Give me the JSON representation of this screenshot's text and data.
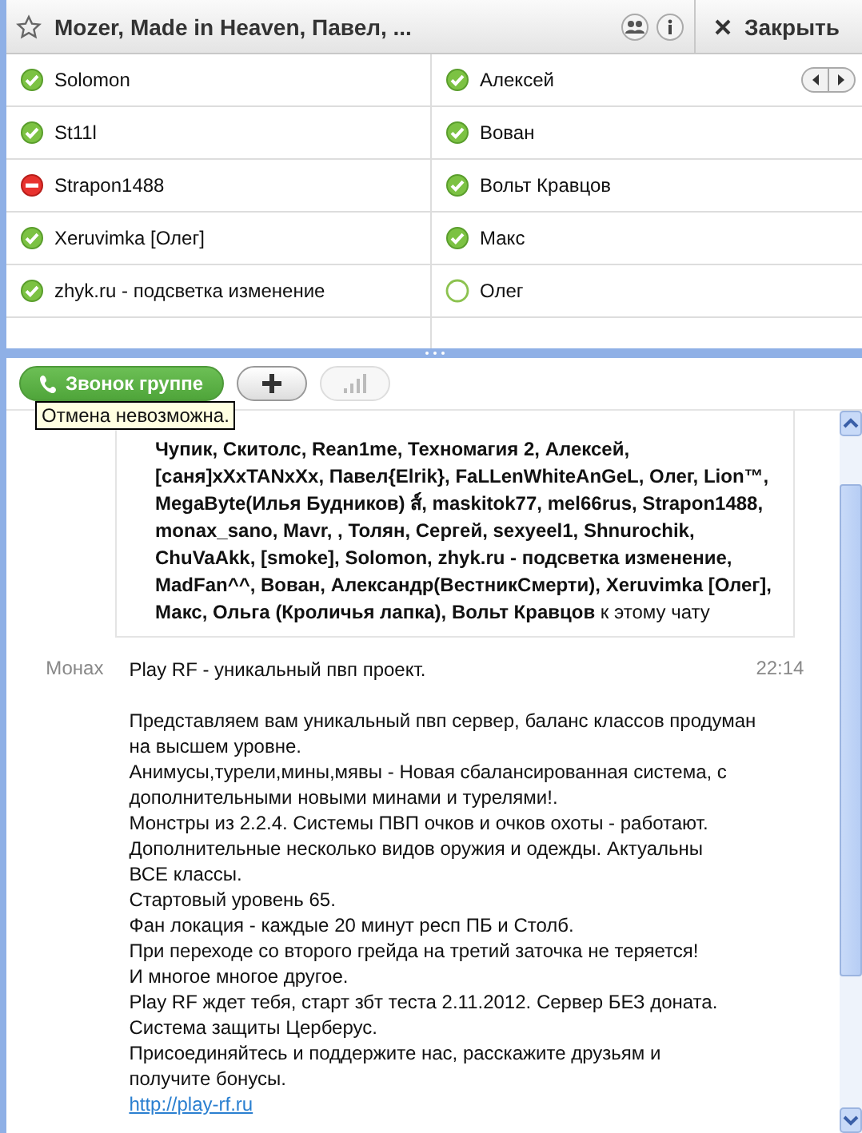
{
  "header": {
    "title": "Mozer, Made in Heaven, Павел, ...",
    "favorite": false,
    "close_label": "Закрыть"
  },
  "participants": [
    {
      "name": "Solomon",
      "kind": "online"
    },
    {
      "name": "Алексей",
      "kind": "online"
    },
    {
      "name": "St11l",
      "kind": "online"
    },
    {
      "name": "Вован",
      "kind": "online"
    },
    {
      "name": "Strapon1488",
      "kind": "busy"
    },
    {
      "name": "Вольт Кравцов",
      "kind": "online"
    },
    {
      "name": "Xeruvimka [Олег]",
      "kind": "online"
    },
    {
      "name": "Макс",
      "kind": "online"
    },
    {
      "name": "zhyk.ru - подсветка изменение",
      "kind": "online"
    },
    {
      "name": "Олег",
      "kind": "offline"
    }
  ],
  "toolbar": {
    "call_label": "Звонок группе",
    "tooltip": "Отмена невозможна.",
    "quality_disabled": true
  },
  "system_message": {
    "text": "**Чупик, Скитолс, Rean1me, Техномагия 2, Алексей, [саня]xXxTANxXx, Павел{Elrik}, FaLLenWhiteAnGeL, Олег, Lion™, MegaByte(Илья Будников) ส์, maskitok77, mel66rus, Strapon1488, monax_sano, Mavr, , Толян, Сергей, sexyeel1, Shnurochik, ChuVaAkk, [smoke], Solomon, zhyk.ru - подсветка изменение, MadFan^^, Вован, Александр(ВестникСмерти), Xeruvimka [Олег], Макс, Ольга (Кроличья лапка), Вольт Кравцов** к этому чату"
  },
  "message": {
    "author": "Монах",
    "time": "22:14",
    "headline": "Play RF - уникальный пвп проект.",
    "lines": [
      "Представляем вам уникальный пвп сервер, баланс классов продуман",
      "на высшем уровне.",
      "Анимусы,турели,мины,мявы - Новая сбалансированная система, с",
      "дополнительными новыми минами и турелями!.",
      "Монстры из 2.2.4. Системы ПВП очков и очков охоты - работают.",
      "Дополнительные несколько видов оружия и одежды. Актуальны",
      "ВСЕ классы.",
      "Стартовый уровень 65.",
      "Фан локация - каждые 20 минут респ ПБ и Столб.",
      "При переходе со второго грейда на третий заточка не теряется!",
      "И многое многое другое.",
      "Play RF ждет тебя, старт збт теста 2.11.2012. Сервер БЕЗ доната.",
      "Система защиты Церберус.",
      "Присоединяйтесь и поддержите нас, расскажите друзьям и",
      "получите бонусы."
    ],
    "link": "http://play-rf.ru"
  }
}
